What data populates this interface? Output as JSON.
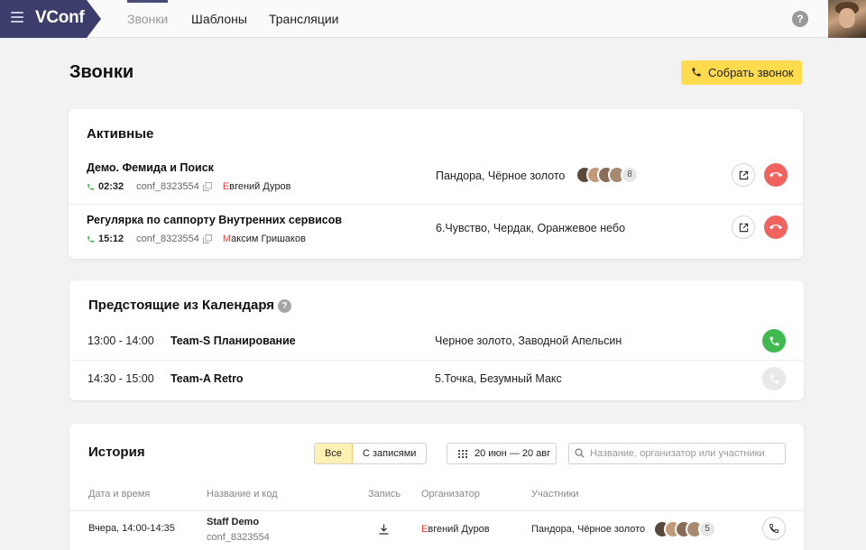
{
  "app": {
    "name": "VConf"
  },
  "nav": {
    "tabs": [
      "Звонки",
      "Шаблоны",
      "Трансляции"
    ]
  },
  "page": {
    "title": "Звонки",
    "create_call_label": "Собрать звонок"
  },
  "active": {
    "title": "Активные",
    "calls": [
      {
        "name": "Демо. Фемида и Поиск",
        "duration": "02:32",
        "code": "conf_8323554",
        "organizer_initial": "Е",
        "organizer_rest": "вгений Дуров",
        "rooms": "Пандора, Чёрное золото",
        "extra_count": "8"
      },
      {
        "name": "Регулярка по саппорту Внутренних сервисов",
        "duration": "15:12",
        "code": "conf_8323554",
        "organizer_initial": "М",
        "organizer_rest": "аксим Гришаков",
        "rooms": "6.Чувство, Чердак, Оранжевое небо"
      }
    ]
  },
  "upcoming": {
    "title": "Предстоящие из Календаря",
    "events": [
      {
        "time": "13:00 - 14:00",
        "name": "Team-S Планирование",
        "rooms": "Черное золото, Заводной Апельсин"
      },
      {
        "time": "14:30 - 15:00",
        "name": "Team-A Retro",
        "rooms": "5.Точка, Безумный Макс"
      }
    ]
  },
  "history": {
    "title": "История",
    "filters": [
      "Все",
      "С записями"
    ],
    "date_range": "20 июн — 20 авг",
    "search_placeholder": "Название, организатор или участники",
    "columns": [
      "Дата и время",
      "Название и код",
      "Запись",
      "Организатор",
      "Участники"
    ],
    "rows": [
      {
        "datetime": "Вчера, 14:00-14:35",
        "name": "Staff Demo",
        "code": "conf_8323554",
        "organizer_initial": "Е",
        "organizer_rest": "вгений Дуров",
        "rooms": "Пандора, Чёрное золото",
        "extra_count": "5"
      }
    ]
  },
  "colors": {
    "accent_yellow": "#ffdb4d",
    "brand_dark": "#3d3d6b",
    "hangup_red": "#f1635e",
    "join_green": "#3fb950"
  }
}
